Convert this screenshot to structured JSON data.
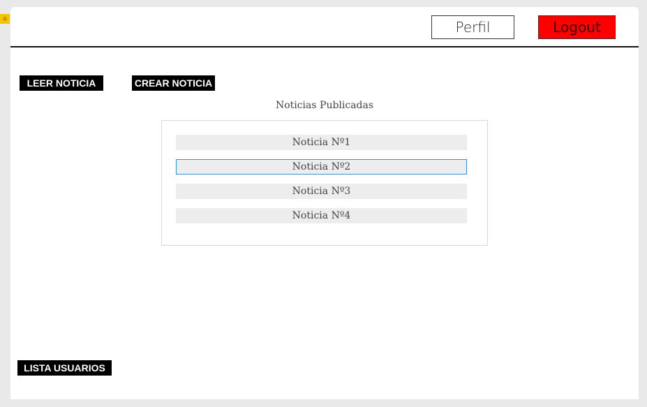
{
  "header": {
    "profile_label": "Perfil",
    "logout_label": "Logout"
  },
  "actions": {
    "read_label": "LEER NOTICIA",
    "create_label": "CREAR NOTICIA",
    "users_label": "LISTA USUARIOS"
  },
  "news": {
    "title": "Noticias Publicadas",
    "items": [
      {
        "label": "Noticia Nº1",
        "selected": false
      },
      {
        "label": "Noticia Nº2",
        "selected": true
      },
      {
        "label": "Noticia Nº3",
        "selected": false
      },
      {
        "label": "Noticia Nº4",
        "selected": false
      }
    ]
  },
  "colors": {
    "logout_bg": "#ff0000",
    "selected_border": "#3b8fd6",
    "button_bg": "#000000"
  },
  "icons": {
    "home": "home-icon"
  }
}
